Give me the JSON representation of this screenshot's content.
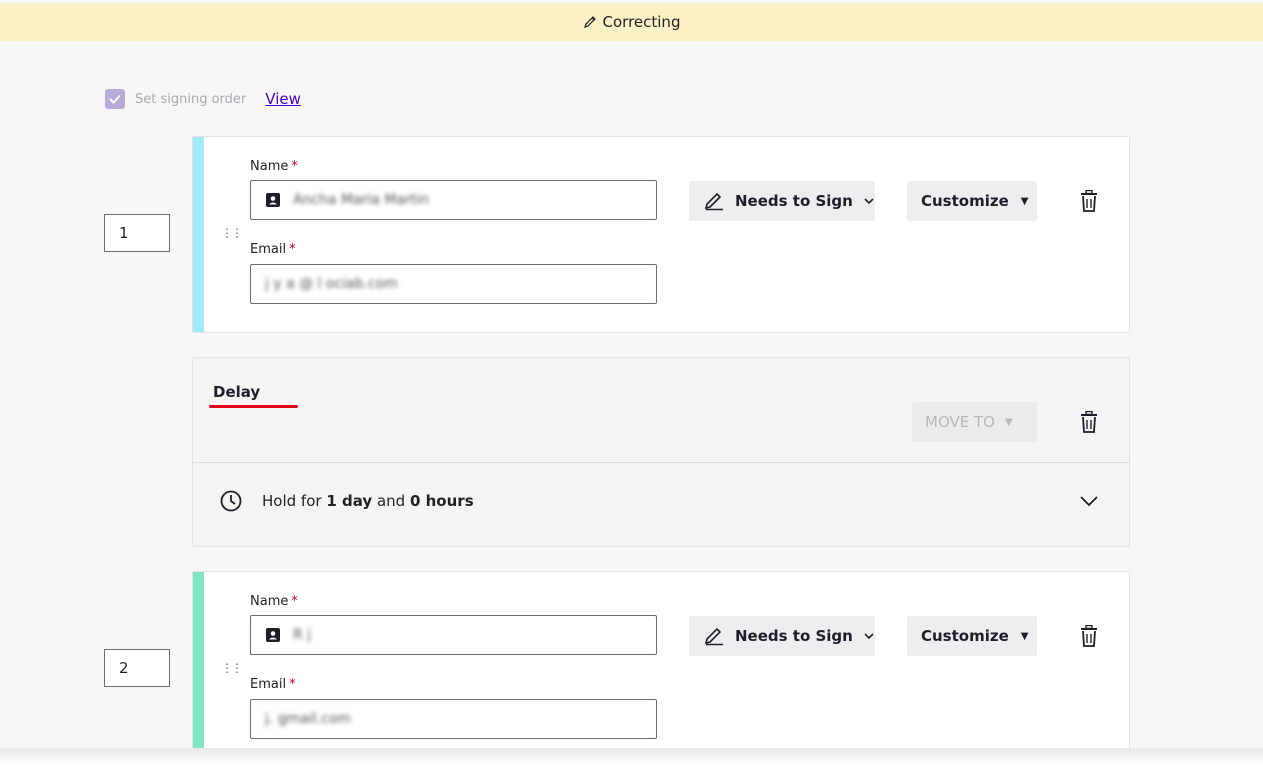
{
  "banner": {
    "status": "Correcting",
    "icon": "pencil-icon"
  },
  "signing_order": {
    "label": "Set signing order",
    "checked": true,
    "view_link": "View"
  },
  "recipients": [
    {
      "order": "1",
      "stripe_color": "#a3ebfa",
      "name_label": "Name",
      "name_value": "Ancha Maria Martin",
      "email_label": "Email",
      "email_value": "j y          a @ l  ociab.com",
      "required_mark": "*",
      "action": "Needs to Sign",
      "customize": "Customize"
    },
    {
      "order": "2",
      "stripe_color": "#7fe8c2",
      "name_label": "Name",
      "name_value": "R j",
      "email_label": "Email",
      "email_value": "j.                       gmail.com",
      "required_mark": "*",
      "action": "Needs to Sign",
      "customize": "Customize"
    }
  ],
  "delay": {
    "title": "Delay",
    "move_to": "MOVE TO",
    "hold_prefix": "Hold for",
    "days": "1 day",
    "and": "and",
    "hours": "0 hours"
  }
}
